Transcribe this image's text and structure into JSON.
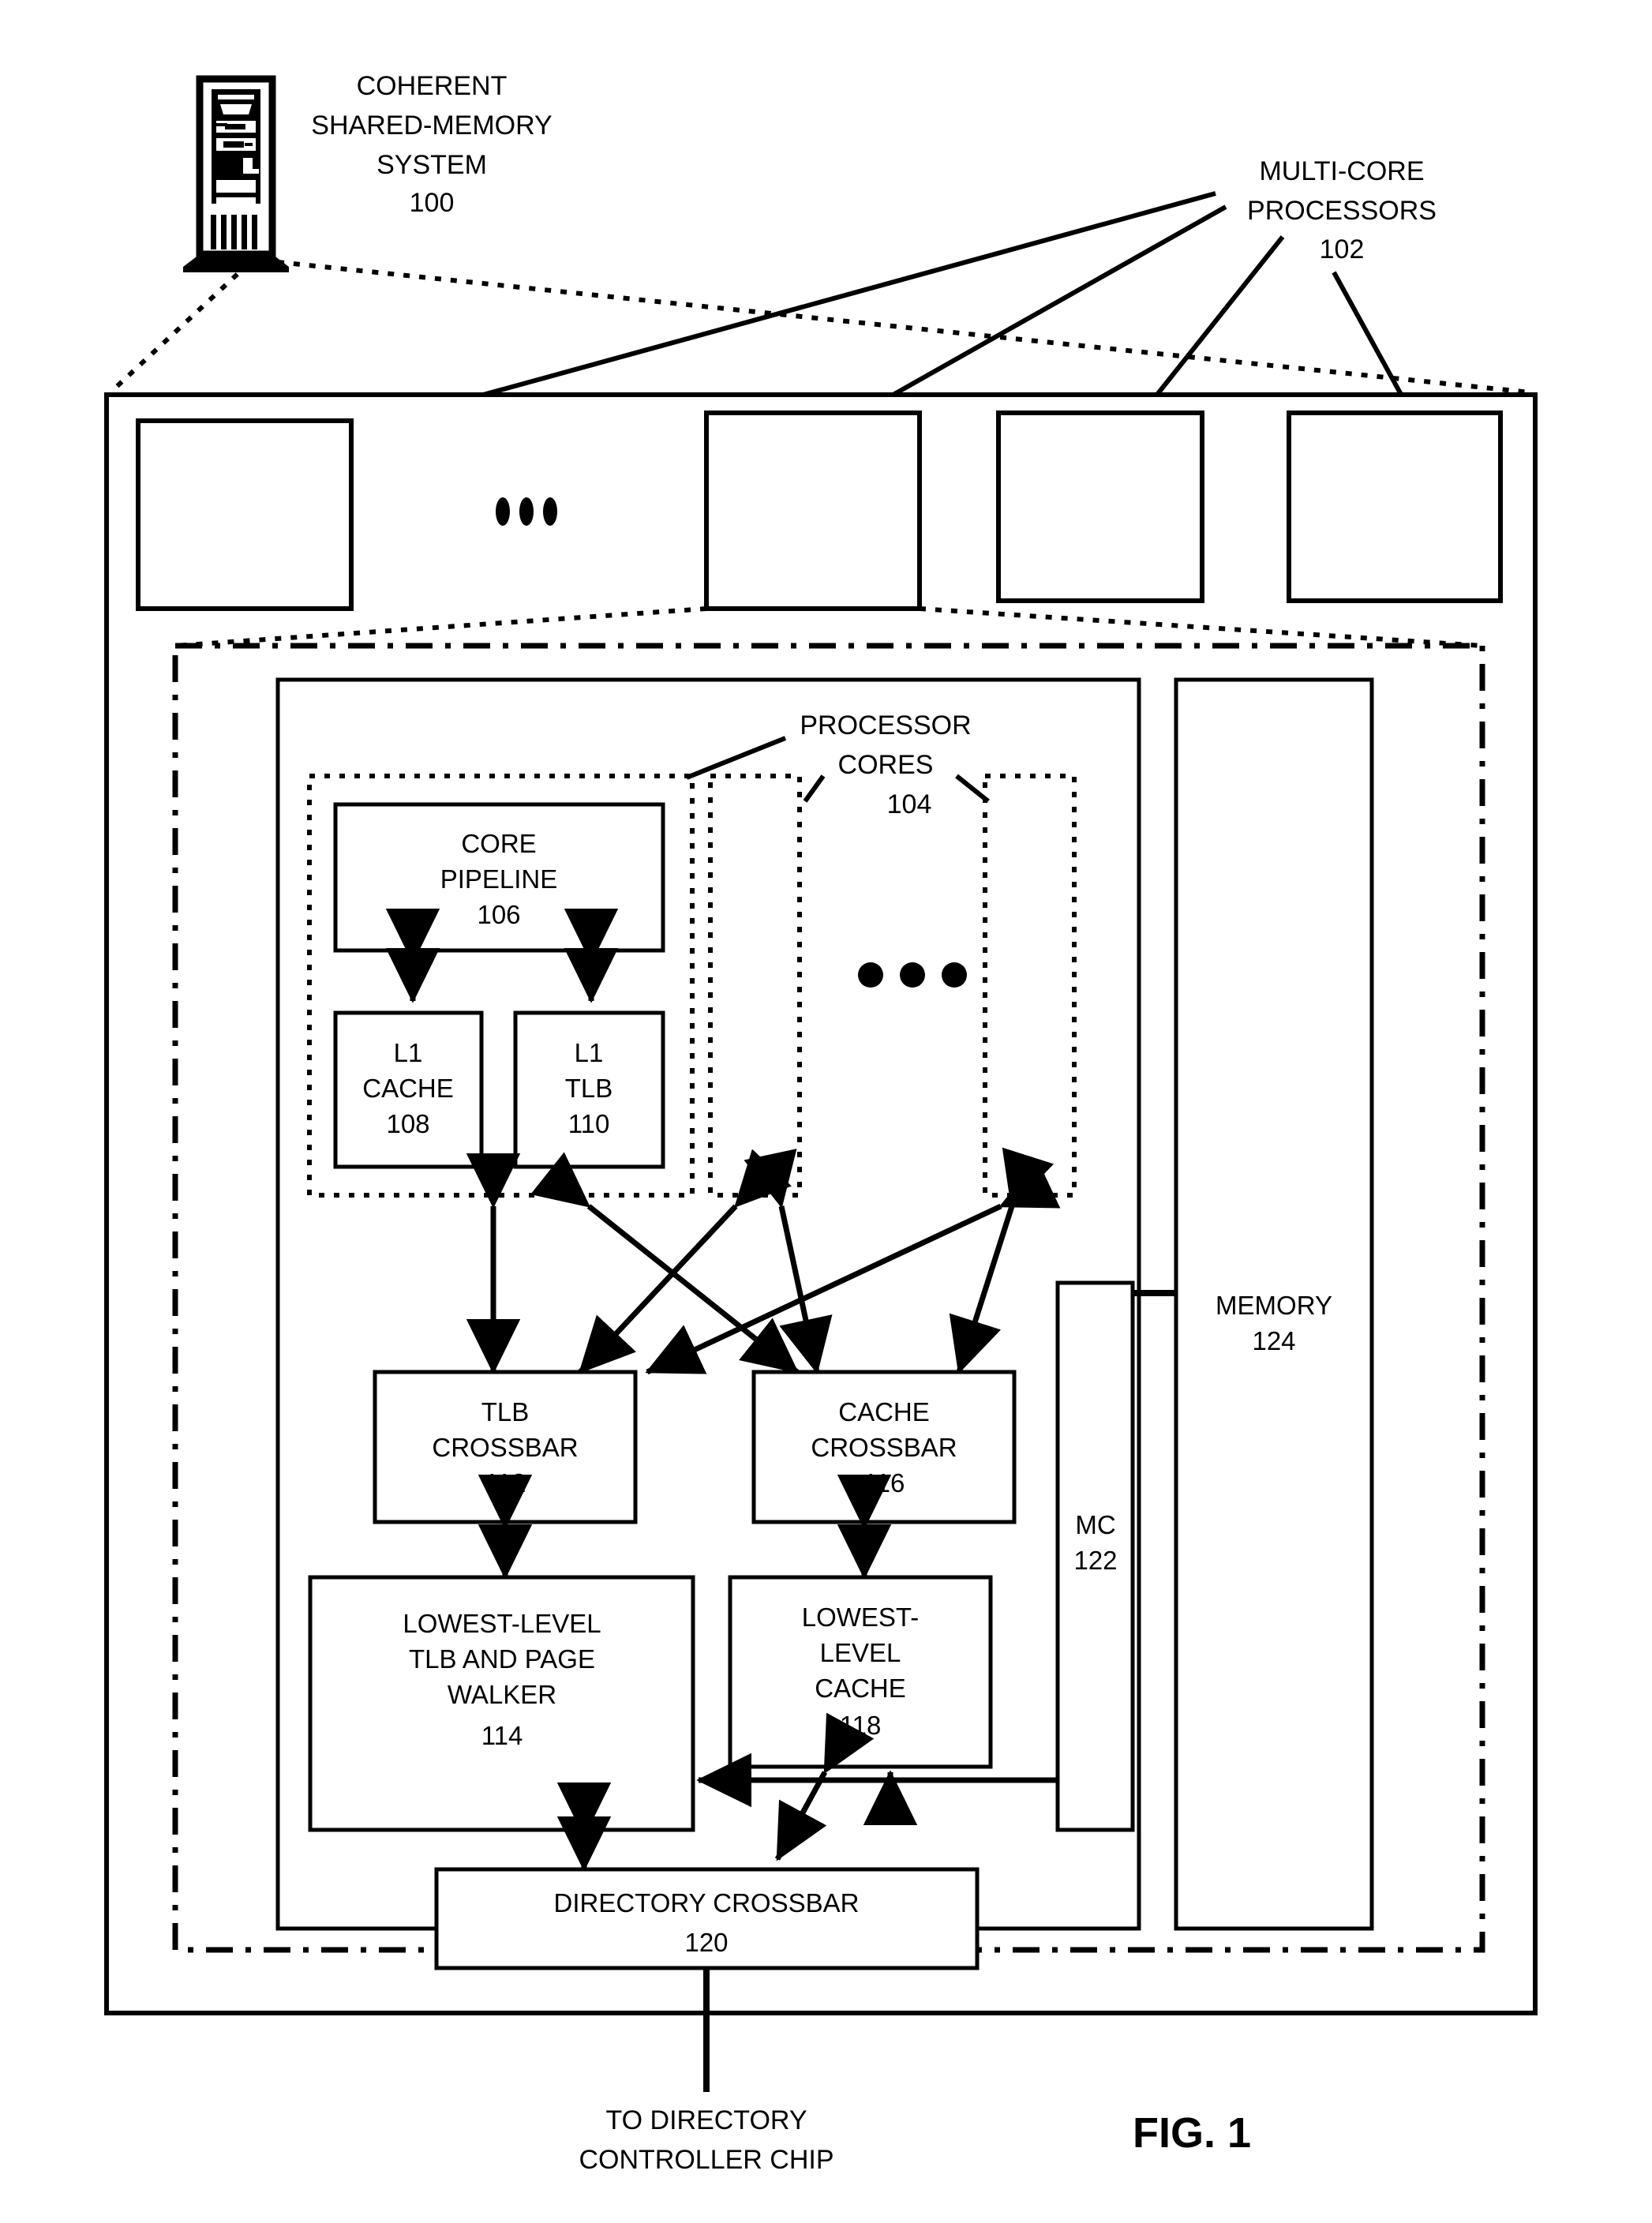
{
  "figure": {
    "label": "FIG. 1",
    "system_title_lines": [
      "COHERENT",
      "SHARED-MEMORY",
      "SYSTEM"
    ],
    "system_ref": "100",
    "server_icon": "server-tower-icon"
  },
  "callouts": {
    "multicore": {
      "lines": [
        "MULTI-CORE",
        "PROCESSORS"
      ],
      "ref": "102"
    },
    "processor_cores": {
      "lines": [
        "PROCESSOR",
        "CORES"
      ],
      "ref": "104"
    }
  },
  "processor_row": {
    "ellipsis": "• • •",
    "boxes": [
      {
        "name": "processor-box-1"
      },
      {
        "name": "processor-box-2"
      },
      {
        "name": "processor-box-3"
      },
      {
        "name": "processor-box-4"
      }
    ]
  },
  "core": {
    "pipeline": {
      "lines": [
        "CORE",
        "PIPELINE"
      ],
      "ref": "106"
    },
    "l1_cache": {
      "lines": [
        "L1",
        "CACHE"
      ],
      "ref": "108"
    },
    "l1_tlb": {
      "lines": [
        "L1",
        "TLB"
      ],
      "ref": "110"
    },
    "ellipsis": "• • •"
  },
  "blocks": {
    "tlb_crossbar": {
      "lines": [
        "TLB",
        "CROSSBAR"
      ],
      "ref": "112"
    },
    "cache_crossbar": {
      "lines": [
        "CACHE",
        "CROSSBAR"
      ],
      "ref": "116"
    },
    "lowest_level_tlb": {
      "lines": [
        "LOWEST-LEVEL",
        "TLB AND PAGE",
        "WALKER"
      ],
      "ref": "114"
    },
    "lowest_level_cache": {
      "lines": [
        "LOWEST-",
        "LEVEL",
        "CACHE"
      ],
      "ref": "118"
    },
    "directory_crossbar": {
      "lines": [
        "DIRECTORY CROSSBAR"
      ],
      "ref": "120"
    },
    "mc": {
      "lines": [
        "MC"
      ],
      "ref": "122"
    },
    "memory": {
      "lines": [
        "MEMORY"
      ],
      "ref": "124"
    }
  },
  "footer": {
    "to_directory_lines": [
      "TO DIRECTORY",
      "CONTROLLER CHIP"
    ]
  },
  "colors": {
    "ink": "#000000",
    "paper": "#ffffff"
  }
}
